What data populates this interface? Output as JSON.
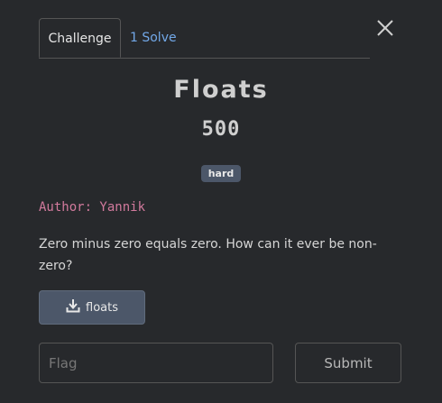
{
  "tabs": [
    {
      "label": "Challenge",
      "active": true
    },
    {
      "label": "1 Solve",
      "active": false
    }
  ],
  "challenge": {
    "name": "Floats",
    "points": "500",
    "difficulty": "hard",
    "author": "Author: Yannik",
    "description": "Zero minus zero equals zero. How can it ever be non-zero?"
  },
  "file": {
    "label": "floats",
    "icon": "download-icon"
  },
  "flag": {
    "placeholder": "Flag",
    "value": ""
  },
  "submit": {
    "label": "Submit"
  },
  "colors": {
    "background": "#27292c",
    "accent_link": "#72a8e8",
    "author": "#d27a9d",
    "badge": "#4c5769"
  }
}
